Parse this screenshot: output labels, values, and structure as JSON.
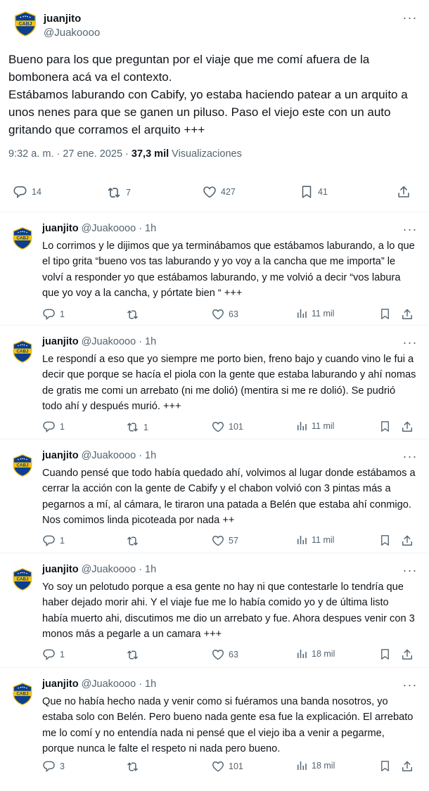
{
  "main_tweet": {
    "author_name": "juanjito",
    "author_handle": "@Juakoooo",
    "text": "Bueno para los que preguntan por el viaje que me comí afuera de la bombonera acá va el contexto.\nEstábamos laburando con Cabify, yo estaba haciendo patear a un arquito a unos nenes para que se ganen un piluso. Paso el viejo este con un auto gritando que corramos el arquito +++",
    "time": "9:32 a. m. · 27 ene. 2025 · ",
    "views_count": "37,3 mil",
    "views_label": " Visualizaciones",
    "replies": "14",
    "reposts": "7",
    "likes": "427",
    "bookmarks": "41"
  },
  "replies": [
    {
      "name": "juanjito",
      "handle_time": "@Juakoooo · 1h",
      "text": "Lo corrimos y le dijimos que ya terminábamos que estábamos laburando, a lo que el tipo grita “bueno vos tas laburando y yo voy a la cancha que me importa” le volví a responder yo que estábamos laburando, y me volvió a decir “vos labura que yo voy a la cancha, y pórtate bien “ +++",
      "replies": "1",
      "reposts": "",
      "likes": "63",
      "views": "11 mil"
    },
    {
      "name": "juanjito",
      "handle_time": "@Juakoooo · 1h",
      "text": "Le respondí a eso que yo siempre me porto bien, freno bajo y cuando vino le fui a decir que porque se hacía el piola con la gente que estaba laburando y ahí nomas de gratis me comi un arrebato (ni me dolió) (mentira si me re dolió). Se pudrió todo ahí y después murió. +++",
      "replies": "1",
      "reposts": "1",
      "likes": "101",
      "views": "11 mil"
    },
    {
      "name": "juanjito",
      "handle_time": "@Juakoooo · 1h",
      "text": "Cuando pensé que todo había quedado ahí, volvimos al lugar donde estábamos a cerrar la acción con la gente de Cabify y el chabon volvió con 3 pintas más a pegarnos a mí, al cámara, le tiraron una patada a Belén que estaba ahí conmigo. Nos comimos linda picoteada por nada ++",
      "replies": "1",
      "reposts": "",
      "likes": "57",
      "views": "11 mil"
    },
    {
      "name": "juanjito",
      "handle_time": "@Juakoooo · 1h",
      "text": "Yo soy un pelotudo porque a esa gente no hay ni que contestarle lo tendría que haber dejado morir ahi. Y el viaje fue me lo había comido yo y de última listo había muerto ahi, discutimos me dio un arrebato y fue. Ahora despues venir con 3 monos más a pegarle a un camara +++",
      "replies": "1",
      "reposts": "",
      "likes": "63",
      "views": "18 mil"
    },
    {
      "name": "juanjito",
      "handle_time": "@Juakoooo · 1h",
      "text": "Que no había hecho nada y venir como si fuéramos una banda nosotros, yo estaba solo con Belén. Pero bueno nada gente esa fue la explicación. El arrebato me lo comí y no entendía nada ni pensé que el viejo iba a venir a pegarme, porque nunca le falte el respeto ni nada pero bueno.",
      "replies": "3",
      "reposts": "",
      "likes": "101",
      "views": "18 mil"
    }
  ],
  "colors": {
    "text": "#0f1419",
    "secondary": "#536471",
    "divider": "#eff3f4",
    "boca_blue": "#0b3f8f",
    "boca_yellow": "#f4c20d"
  }
}
